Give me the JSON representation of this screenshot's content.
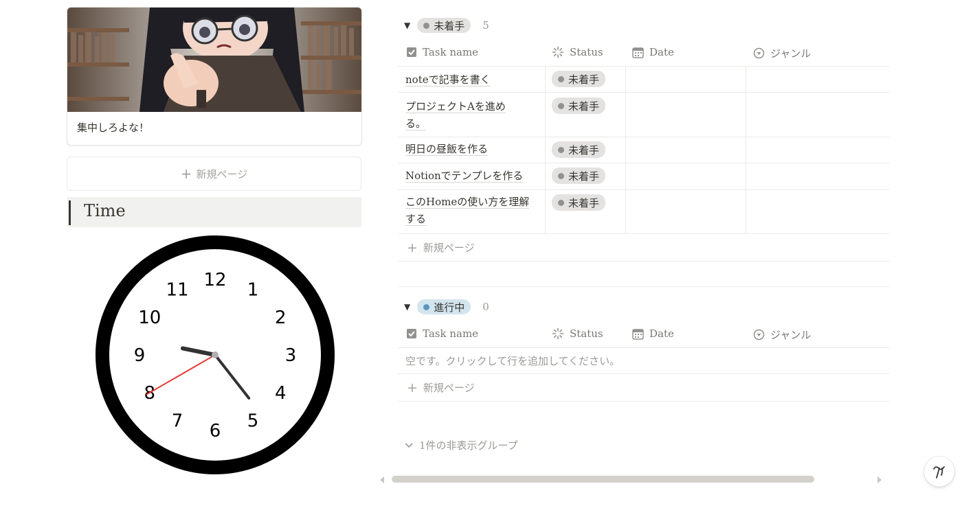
{
  "card": {
    "title": "集中しろよな！",
    "image_icon": "anime-girl-pointing-image"
  },
  "new_page_label": "新規ページ",
  "time_heading": "Time",
  "clock": {
    "numbers": [
      "12",
      "1",
      "2",
      "3",
      "4",
      "5",
      "6",
      "7",
      "8",
      "9",
      "10",
      "11"
    ],
    "hour": 9,
    "minute": 23,
    "second": 40,
    "hand_color": "#333333",
    "second_hand_color": "#e53935"
  },
  "columns": {
    "task_name": "Task name",
    "status": "Status",
    "date": "Date",
    "genre": "ジャンル"
  },
  "groups": [
    {
      "label": "未着手",
      "count": "5",
      "color": "gray",
      "rows": [
        {
          "task": "noteで記事を書く",
          "status": "未着手"
        },
        {
          "task": "プロジェクトAを進める。",
          "status": "未着手"
        },
        {
          "task": "明日の昼飯を作る",
          "status": "未着手"
        },
        {
          "task": "Notionでテンプレを作る",
          "status": "未着手"
        },
        {
          "task": "このHomeの使い方を理解する",
          "status": "未着手"
        }
      ]
    },
    {
      "label": "進行中",
      "count": "0",
      "color": "blue",
      "empty_text": "空です。クリックして行を追加してください。"
    }
  ],
  "hidden_groups_label": "1件の非表示グループ",
  "colors": {
    "text": "#37352f",
    "muted": "#9b9a97",
    "border": "#e9e9e7",
    "gray_pill": "#e3e2e0",
    "blue_pill": "#d3e5ef"
  }
}
